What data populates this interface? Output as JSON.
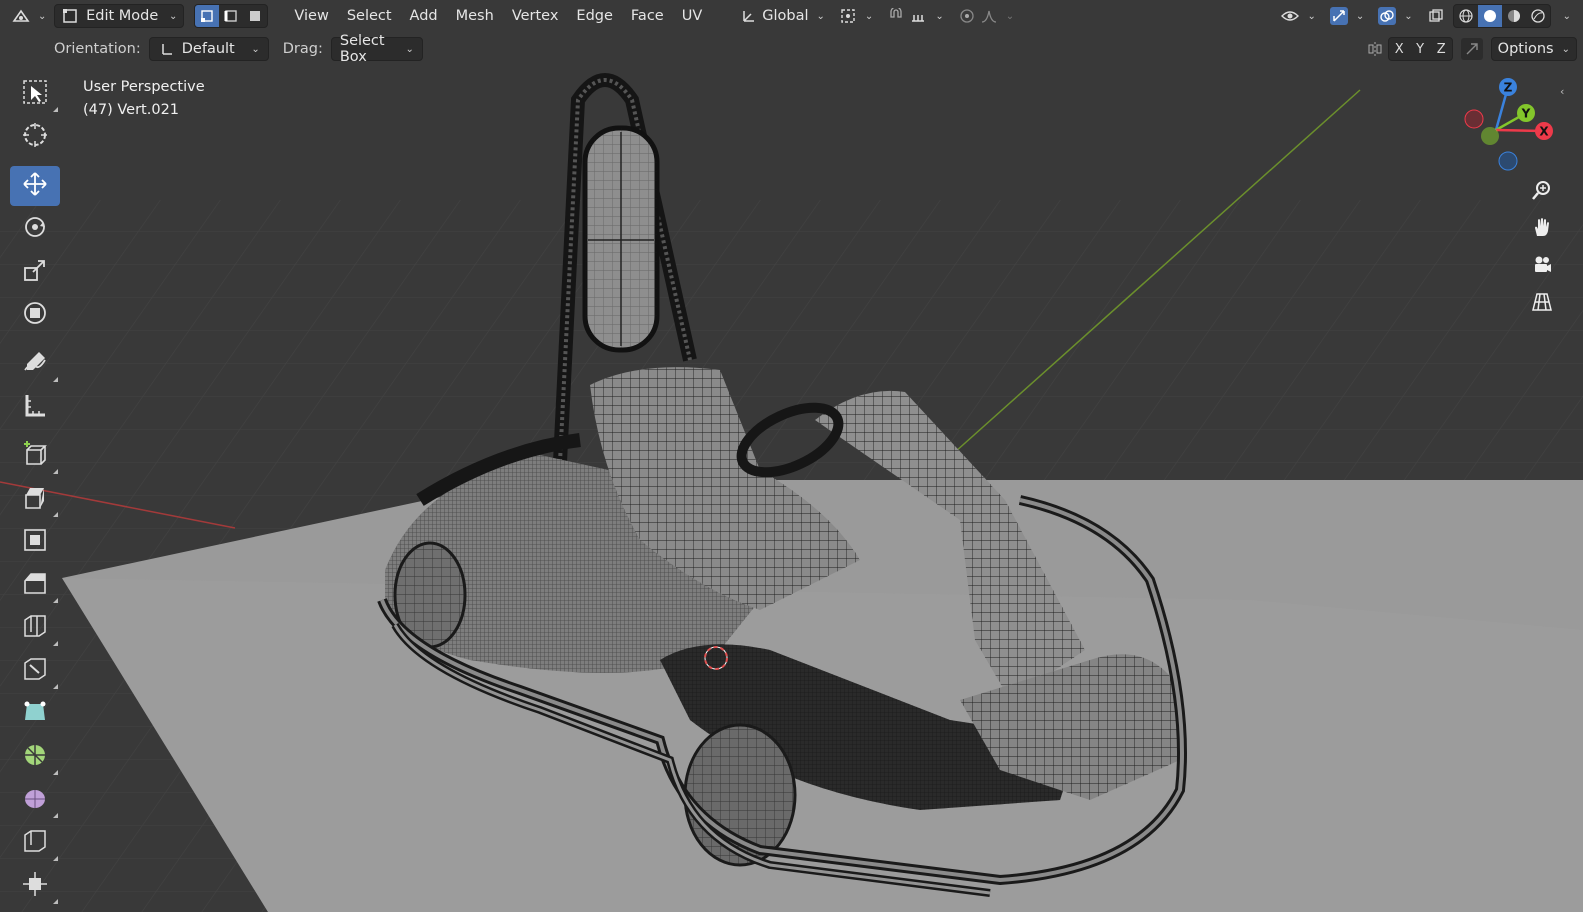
{
  "header": {
    "editor_type_icon": "editor-type-icon",
    "mode": "Edit Mode",
    "select_modes": [
      "vertex-select-icon",
      "edge-select-icon",
      "face-select-icon"
    ],
    "menus": [
      "View",
      "Select",
      "Add",
      "Mesh",
      "Vertex",
      "Edge",
      "Face",
      "UV"
    ],
    "transform_orientation": "Global",
    "options": "Options",
    "axes": [
      "X",
      "Y",
      "Z"
    ]
  },
  "tool_settings": {
    "orientation_label": "Orientation:",
    "orientation_value": "Default",
    "drag_label": "Drag:",
    "drag_value": "Select Box"
  },
  "viewport": {
    "view_name": "User Perspective",
    "object_info": "(47) Vert.021"
  },
  "gizmo": {
    "z": "Z",
    "y": "Y",
    "x": "X"
  },
  "colors": {
    "accent": "#4772b3",
    "background": "#393939",
    "x_axis": "#ee3a4a",
    "y_axis": "#83c62b",
    "z_axis": "#3a82dd"
  }
}
